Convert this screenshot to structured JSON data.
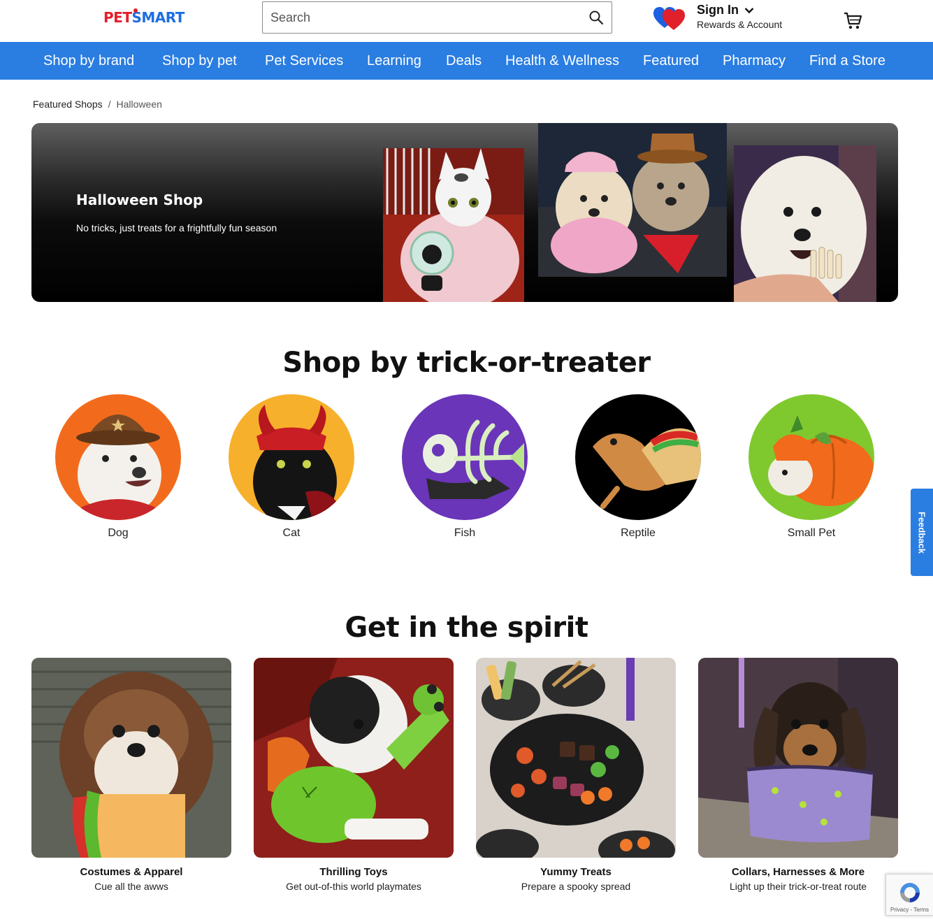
{
  "header": {
    "logo_left": "PET",
    "logo_right": "SMART",
    "search_placeholder": "Search",
    "signin_title": "Sign In",
    "signin_sub": "Rewards & Account"
  },
  "nav": {
    "items": [
      "Shop by brand",
      "Shop by pet",
      "Pet Services",
      "Learning",
      "Deals",
      "Health & Wellness",
      "Featured",
      "Pharmacy",
      "Find a Store"
    ]
  },
  "breadcrumb": {
    "parent": "Featured Shops",
    "separator": "/",
    "current": "Halloween"
  },
  "hero": {
    "title": "Halloween Shop",
    "subtitle": "No tricks, just treats for a frightfully fun season"
  },
  "trick_section": {
    "title": "Shop by trick-or-treater",
    "pets": [
      {
        "label": "Dog",
        "bg": "#f26b1d"
      },
      {
        "label": "Cat",
        "bg": "#f7b02b"
      },
      {
        "label": "Fish",
        "bg": "#6a35b8"
      },
      {
        "label": "Reptile",
        "bg": "#000000"
      },
      {
        "label": "Small Pet",
        "bg": "#7fc92e"
      }
    ]
  },
  "spirit_section": {
    "title": "Get in the spirit",
    "cards": [
      {
        "title": "Costumes & Apparel",
        "subtitle": "Cue all the awws"
      },
      {
        "title": "Thrilling Toys",
        "subtitle": "Get out-of-this world playmates"
      },
      {
        "title": "Yummy Treats",
        "subtitle": "Prepare a spooky spread"
      },
      {
        "title": "Collars, Harnesses & More",
        "subtitle": "Light up their trick-or-treat route"
      }
    ]
  },
  "feedback_label": "Feedback",
  "recaptcha_text": "Privacy - Terms",
  "colors": {
    "brand_blue": "#2a7de1",
    "logo_red": "#e3202b"
  },
  "icons": [
    "search-icon",
    "hearts-icon",
    "chevron-down-icon",
    "cart-icon",
    "recaptcha-icon"
  ]
}
